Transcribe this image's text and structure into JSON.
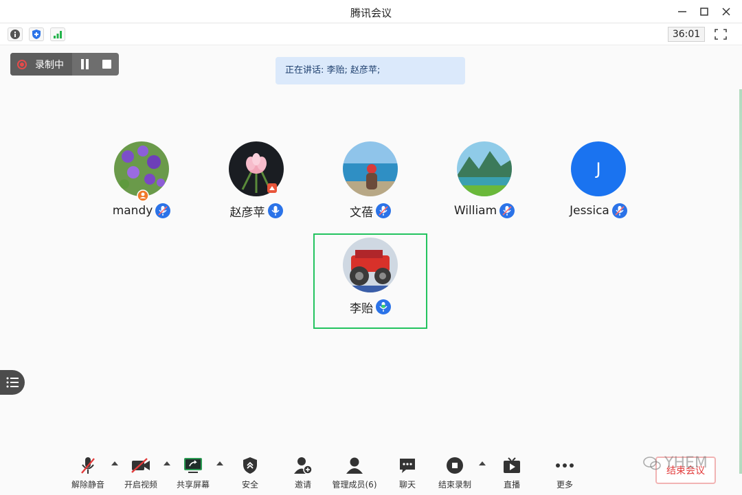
{
  "window": {
    "title": "腾讯会议"
  },
  "toolbar": {
    "timer": "36:01"
  },
  "recording": {
    "label": "录制中"
  },
  "speaking": {
    "text": "正在讲话: 李贻; 赵彦苹;"
  },
  "participants": [
    {
      "name": "mandy"
    },
    {
      "name": "赵彦苹"
    },
    {
      "name": "文蓓"
    },
    {
      "name": "William"
    },
    {
      "name": "Jessica",
      "initial": "J"
    },
    {
      "name": "李贻"
    }
  ],
  "bottom": {
    "unmute": "解除静音",
    "video": "开启视频",
    "share": "共享屏幕",
    "security": "安全",
    "invite": "邀请",
    "members": "管理成员(6)",
    "chat": "聊天",
    "end_record": "结束录制",
    "live": "直播",
    "more": "更多",
    "end_meeting": "结束会议"
  },
  "watermark": {
    "text": "YHEM"
  },
  "colors": {
    "accent": "#2b73e8",
    "selected": "#22c35e",
    "danger": "#e23b3b"
  }
}
